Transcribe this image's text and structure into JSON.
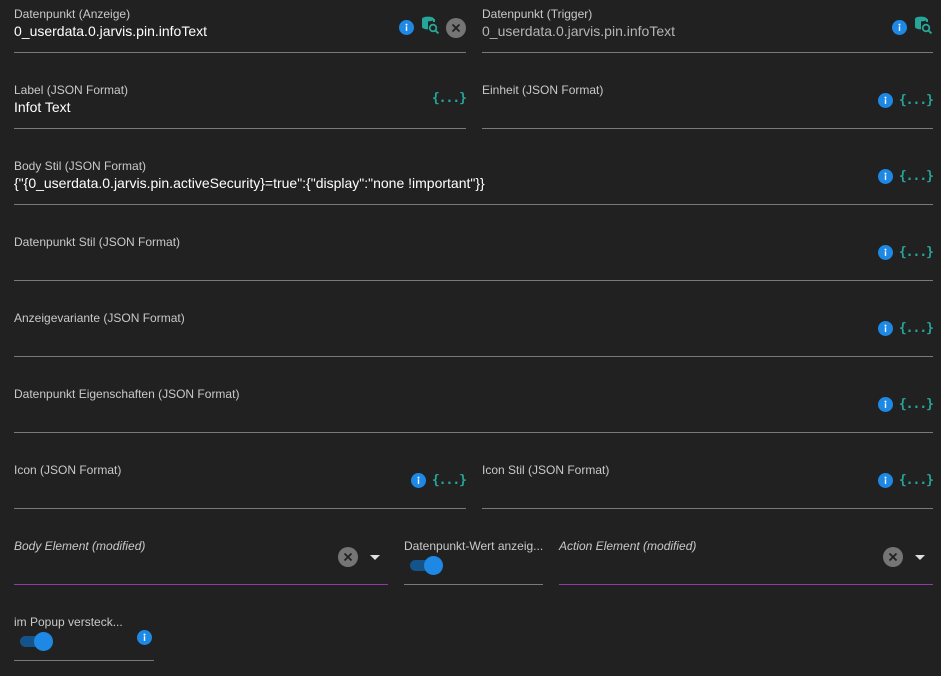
{
  "fields": {
    "dp_display": {
      "label": "Datenpunkt (Anzeige)",
      "value": "0_userdata.0.jarvis.pin.infoText"
    },
    "dp_trigger": {
      "label": "Datenpunkt (Trigger)",
      "value": "0_userdata.0.jarvis.pin.infoText"
    },
    "label_json": {
      "label": "Label (JSON Format)",
      "value": "Infot Text"
    },
    "unit_json": {
      "label": "Einheit (JSON Format)",
      "value": ""
    },
    "body_style": {
      "label": "Body Stil (JSON Format)",
      "value": "{\"{0_userdata.0.jarvis.pin.activeSecurity}=true\":{\"display\":\"none !important\"}}"
    },
    "dp_style": {
      "label": "Datenpunkt Stil (JSON Format)",
      "value": ""
    },
    "display_variant": {
      "label": "Anzeigevariante (JSON Format)",
      "value": ""
    },
    "dp_properties": {
      "label": "Datenpunkt Eigenschaften (JSON Format)",
      "value": ""
    },
    "icon_json": {
      "label": "Icon (JSON Format)",
      "value": ""
    },
    "icon_style": {
      "label": "Icon Stil (JSON Format)",
      "value": ""
    },
    "body_element": {
      "label": "Body Element (modified)"
    },
    "show_dp_value": {
      "label": "Datenpunkt-Wert anzeig...",
      "checked": true
    },
    "action_element": {
      "label": "Action Element (modified)"
    },
    "hide_in_popup": {
      "label": "im Popup versteck...",
      "checked": true
    }
  },
  "icons": {
    "json_glyph": "{...}",
    "info": "info-icon",
    "db_search": "database-search-icon",
    "clear": "close-icon",
    "dropdown": "caret-down-icon"
  },
  "colors": {
    "background": "#212121",
    "accent_blue": "#1e88e5",
    "teal": "#26a69a",
    "purple_underline": "#8e3aa8"
  }
}
